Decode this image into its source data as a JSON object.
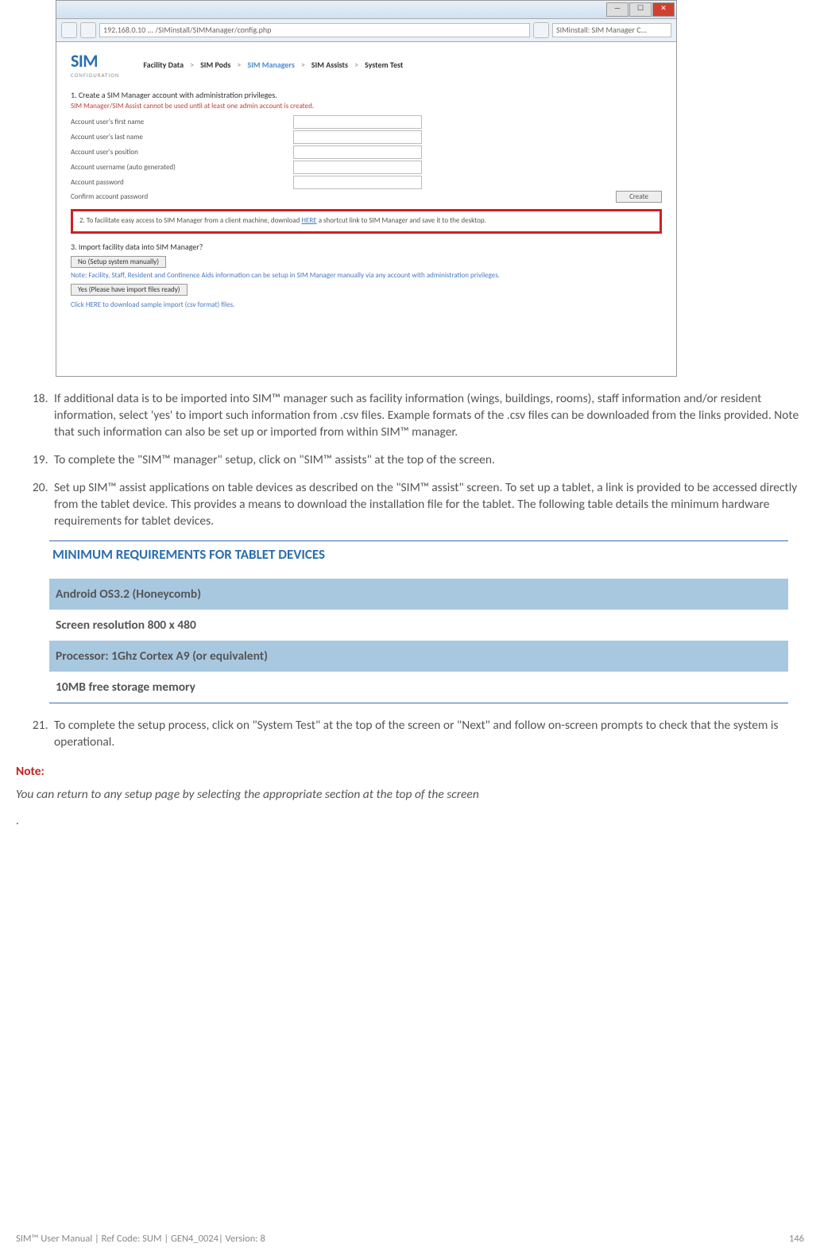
{
  "screenshot": {
    "url": "192.168.0.10 ... /SIMinstall/SIMManager/config.php",
    "tab": "SIMinstall: SIM Manager C...",
    "logo": "SIM",
    "logo_sub": "CONFIGURATION",
    "nav": [
      "Facility Data",
      "SIM Pods",
      "SIM Managers",
      "SIM Assists",
      "System Test"
    ],
    "nav_active_index": 2,
    "step1_title": "1. Create a SIM Manager account with administration privileges.",
    "step1_warn": "SIM Manager/SIM Assist cannot be used until at least one admin account is created.",
    "fields": [
      "Account user's first name",
      "Account user's last name",
      "Account user's position",
      "Account username (auto generated)",
      "Account password"
    ],
    "confirm_label": "Confirm account password",
    "create_btn": "Create",
    "step2_text_a": "2. To facilitate easy access to SIM Manager from a client machine, download ",
    "step2_link": "HERE",
    "step2_text_b": " a shortcut link to SIM Manager and save it to the desktop.",
    "step3_title": "3. Import facility data into SIM Manager?",
    "btn_no": "No (Setup system manually)",
    "step3_note": "Note: Facility, Staff, Resident and Continence Aids information can be setup in SIM Manager manually via any account with administration privileges.",
    "btn_yes": "Yes (Please have import files ready)",
    "dl_text": "Click HERE to download sample import (csv format) files."
  },
  "list": {
    "i18": "If additional data is to be imported into SIM™ manager such as facility information (wings, buildings, rooms), staff information and/or resident information, select 'yes' to import such information from .csv files.  Example formats of the .csv files can be downloaded from the links provided.  Note that such information can also be set up or imported from within SIM™ manager.",
    "i19": "To complete the \"SIM™ manager\" setup, click on \"SIM™ assists\" at the top of the screen.",
    "i20": "Set up SIM™ assist applications on table devices as described on the \"SIM™ assist\" screen.  To set up a tablet, a link is provided to be accessed directly from the tablet device.  This provides a means to download the installation file for the tablet. The following table details the minimum hardware requirements for tablet devices.",
    "i21": "To complete the setup process, click on \"System Test\" at the top of the screen or \"Next\" and follow on-screen prompts to check that the system is operational."
  },
  "req": {
    "title": "MINIMUM REQUIREMENTS FOR TABLET DEVICES",
    "rows": [
      "Android OS3.2 (Honeycomb)",
      "Screen resolution 800 x 480",
      "Processor:  1Ghz Cortex A9 (or equivalent)",
      "10MB free storage memory"
    ]
  },
  "note_label": "Note:",
  "note_text": "You can return to any setup page by selecting the appropriate section at the top of the screen",
  "dot": ".",
  "footer_left": "SIM™ User Manual | Ref Code: SUM | GEN4_0024| Version: 8",
  "footer_right": "146"
}
